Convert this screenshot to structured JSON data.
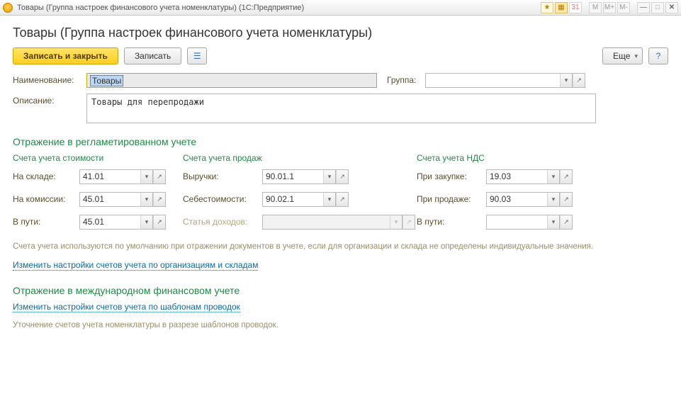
{
  "titlebar": {
    "title": "Товары (Группа настроек финансового учета номенклатуры)  (1С:Предприятие)",
    "app_icon_glyph": "1с"
  },
  "form": {
    "title": "Товары (Группа настроек финансового учета номенклатуры)"
  },
  "toolbar": {
    "save_close": "Записать и закрыть",
    "save": "Записать",
    "more": "Еще",
    "help": "?"
  },
  "fields": {
    "name_label": "Наименование:",
    "name_value": "Товары",
    "group_label": "Группа:",
    "group_value": "",
    "desc_label": "Описание:",
    "desc_value": "Товары для перепродажи"
  },
  "sections": {
    "reg_accounting": "Отражение в регламетированном учете",
    "cost_accounts": "Счета учета стоимости",
    "sales_accounts": "Счета учета продаж",
    "vat_accounts": "Счета учета НДС",
    "ifrs": "Отражение в международном финансовом учете"
  },
  "cost": {
    "in_stock_label": "На складе:",
    "in_stock_value": "41.01",
    "on_commission_label": "На комиссии:",
    "on_commission_value": "45.01",
    "in_transit_label": "В пути:",
    "in_transit_value": "45.01"
  },
  "sales": {
    "revenue_label": "Выручки:",
    "revenue_value": "90.01.1",
    "cogs_label": "Себестоимости:",
    "cogs_value": "90.02.1",
    "income_item_label": "Статья доходов:",
    "income_item_value": ""
  },
  "vat": {
    "on_purchase_label": "При закупке:",
    "on_purchase_value": "19.03",
    "on_sale_label": "При продаже:",
    "on_sale_value": "90.03",
    "in_transit_label": "В пути:",
    "in_transit_value": ""
  },
  "hints": {
    "accounts_default": "Счета учета используются по умолчанию при отражении документов в учете, если для организации и склада не определены индивидуальные значения.",
    "ifrs_note": "Уточнение счетов учета номенклатуры в разрезе шаблонов проводок."
  },
  "links": {
    "accounts_by_org": "Изменить настройки счетов учета по организациям и складам",
    "accounts_by_template": "Изменить настройки счетов учета по шаблонам проводок"
  }
}
